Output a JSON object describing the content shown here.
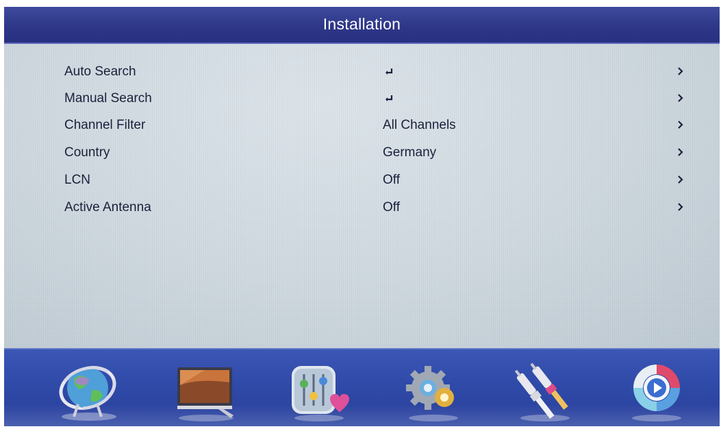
{
  "header": {
    "title": "Installation"
  },
  "menu": {
    "items": [
      {
        "label": "Auto Search",
        "value": "",
        "value_icon": "enter-icon"
      },
      {
        "label": "Manual Search",
        "value": "",
        "value_icon": "enter-icon"
      },
      {
        "label": "Channel Filter",
        "value": "All Channels"
      },
      {
        "label": "Country",
        "value": "Germany"
      },
      {
        "label": "LCN",
        "value": "Off"
      },
      {
        "label": "Active Antenna",
        "value": "Off"
      }
    ],
    "row_arrow_icon": "chevron-right-icon"
  },
  "bottom_nav": {
    "icons": [
      "globe-channel-icon",
      "tv-picture-icon",
      "sound-equalizer-icon",
      "settings-gear-icon",
      "av-connector-icon",
      "media-play-icon"
    ]
  },
  "colors": {
    "title_bar": "#2e3788",
    "content_bg": "#cdd7de",
    "bottom_bar": "#2f4aa8",
    "text": "#1b1f3a"
  }
}
